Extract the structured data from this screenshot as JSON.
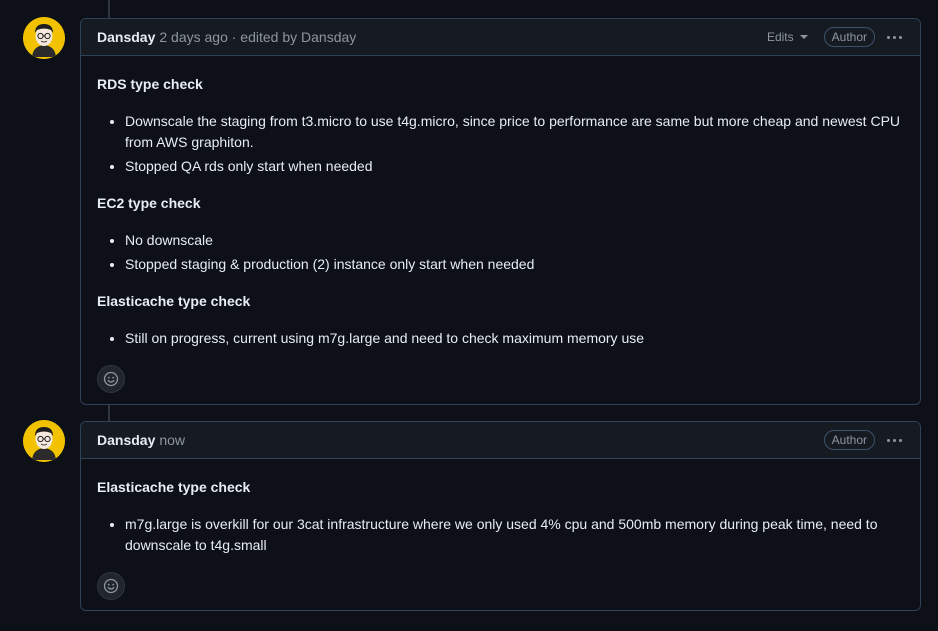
{
  "comments": [
    {
      "author": "Dansday",
      "meta": "2 days ago · edited by Dansday",
      "edits_label": "Edits",
      "badge": "Author",
      "sections": [
        {
          "heading": "RDS type check",
          "items": [
            "Downscale the staging from t3.micro to use t4g.micro, since price to performance are same but more cheap and newest CPU from AWS graphiton.",
            "Stopped QA rds only start when needed"
          ]
        },
        {
          "heading": "EC2 type check",
          "items": [
            "No downscale",
            "Stopped staging & production (2) instance only start when needed"
          ]
        },
        {
          "heading": "Elasticache type check",
          "items": [
            "Still on progress, current using m7g.large and need to check maximum memory use"
          ]
        }
      ]
    },
    {
      "author": "Dansday",
      "meta": "now",
      "badge": "Author",
      "sections": [
        {
          "heading": "Elasticache type check",
          "items": [
            "m7g.large is overkill for our 3cat infrastructure where we only used 4% cpu and 500mb memory during peak time, need to downscale to t4g.small"
          ]
        }
      ]
    }
  ],
  "icons": {
    "reaction": "smiley-icon",
    "menu": "kebab-horizontal-icon",
    "dropdown": "triangle-down-icon"
  },
  "colors": {
    "background": "#0d1117",
    "header": "#161b22",
    "border": "#30415a",
    "muted": "#8d96a0",
    "avatar": "#f2c200"
  }
}
